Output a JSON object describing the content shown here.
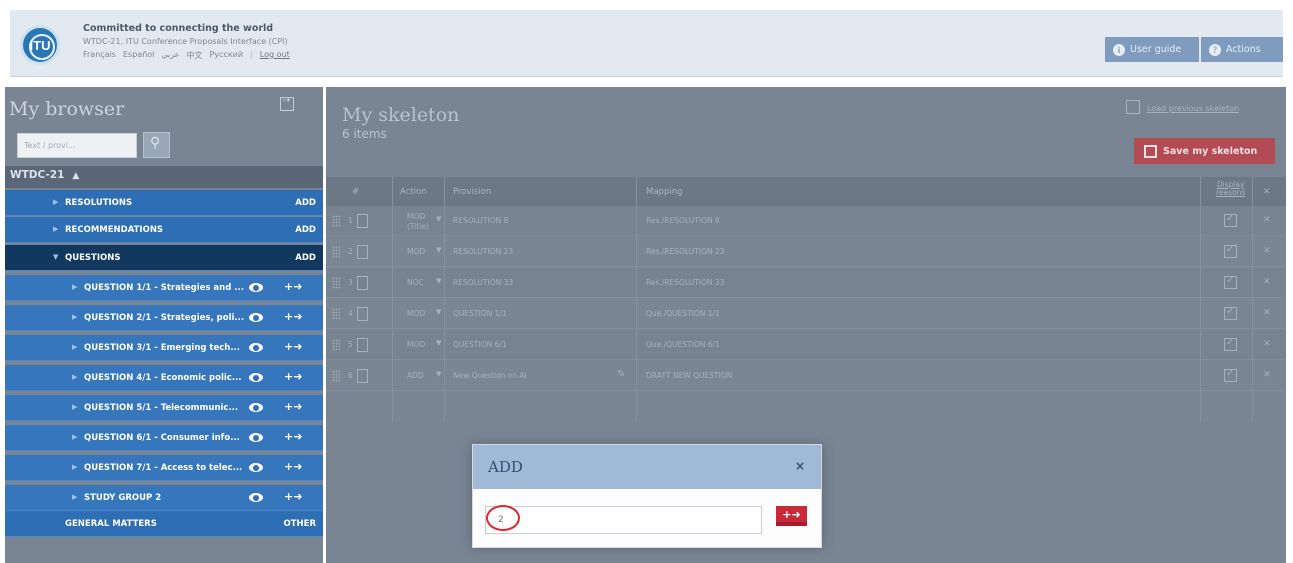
{
  "header": {
    "tagline": "Committed to connecting the world",
    "subtitle": "WTDC-21, ITU Conference Proposals Interface (CPI)",
    "logo_text": "ITU",
    "languages": [
      "Français",
      "Español",
      "عربي",
      "中文",
      "Русский"
    ],
    "logout": "Log out",
    "user_guide": "User guide",
    "actions": "Actions"
  },
  "browser": {
    "title": "My browser",
    "search_placeholder": "Text / provi...",
    "root": "WTDC-21",
    "items": [
      {
        "label": "RESOLUTIONS",
        "right": "ADD"
      },
      {
        "label": "RECOMMENDATIONS",
        "right": "ADD"
      },
      {
        "label": "QUESTIONS",
        "right": "ADD"
      },
      {
        "label": "QUESTION 1/1 - Strategies and ..."
      },
      {
        "label": "QUESTION 2/1 - Strategies, poli..."
      },
      {
        "label": "QUESTION 3/1 - Emerging tech..."
      },
      {
        "label": "QUESTION 4/1 - Economic polic..."
      },
      {
        "label": "QUESTION 5/1 - Telecommunic..."
      },
      {
        "label": "QUESTION 6/1 - Consumer info..."
      },
      {
        "label": "QUESTION 7/1 - Access to telec..."
      },
      {
        "label": "STUDY GROUP 2"
      },
      {
        "label": "GENERAL MATTERS",
        "right": "OTHER"
      }
    ]
  },
  "skeleton": {
    "title": "My skeleton",
    "count": "6 items",
    "load_previous": "Load previous skeleton",
    "save": "Save my skeleton",
    "columns": {
      "num": "#",
      "action": "Action",
      "provision": "Provision",
      "mapping": "Mapping",
      "display": "Display",
      "reasons": "reasons"
    },
    "rows": [
      {
        "num": "1",
        "action": "MOD",
        "action2": "(Title)",
        "provision": "RESOLUTION 8",
        "mapping": "Res./RESOLUTION 8"
      },
      {
        "num": "2",
        "action": "MOD",
        "provision": "RESOLUTION 23",
        "mapping": "Res./RESOLUTION 23"
      },
      {
        "num": "3",
        "action": "NOC",
        "provision": "RESOLUTION 33",
        "mapping": "Res./RESOLUTION 33"
      },
      {
        "num": "4",
        "action": "MOD",
        "provision": "QUESTION 1/1",
        "mapping": "Que./QUESTION 1/1"
      },
      {
        "num": "5",
        "action": "MOD",
        "provision": "QUESTION 6/1",
        "mapping": "Que./QUESTION 6/1"
      },
      {
        "num": "6",
        "action": "ADD",
        "provision": "New Question on AI",
        "mapping": "DRAFT NEW QUESTION"
      }
    ]
  },
  "modal": {
    "title": "ADD",
    "close": "×",
    "input_value": "2"
  },
  "colors": {
    "accent_red": "#c92a37",
    "tree_blue": "#2e6eb4",
    "tree_active": "#12385f"
  }
}
